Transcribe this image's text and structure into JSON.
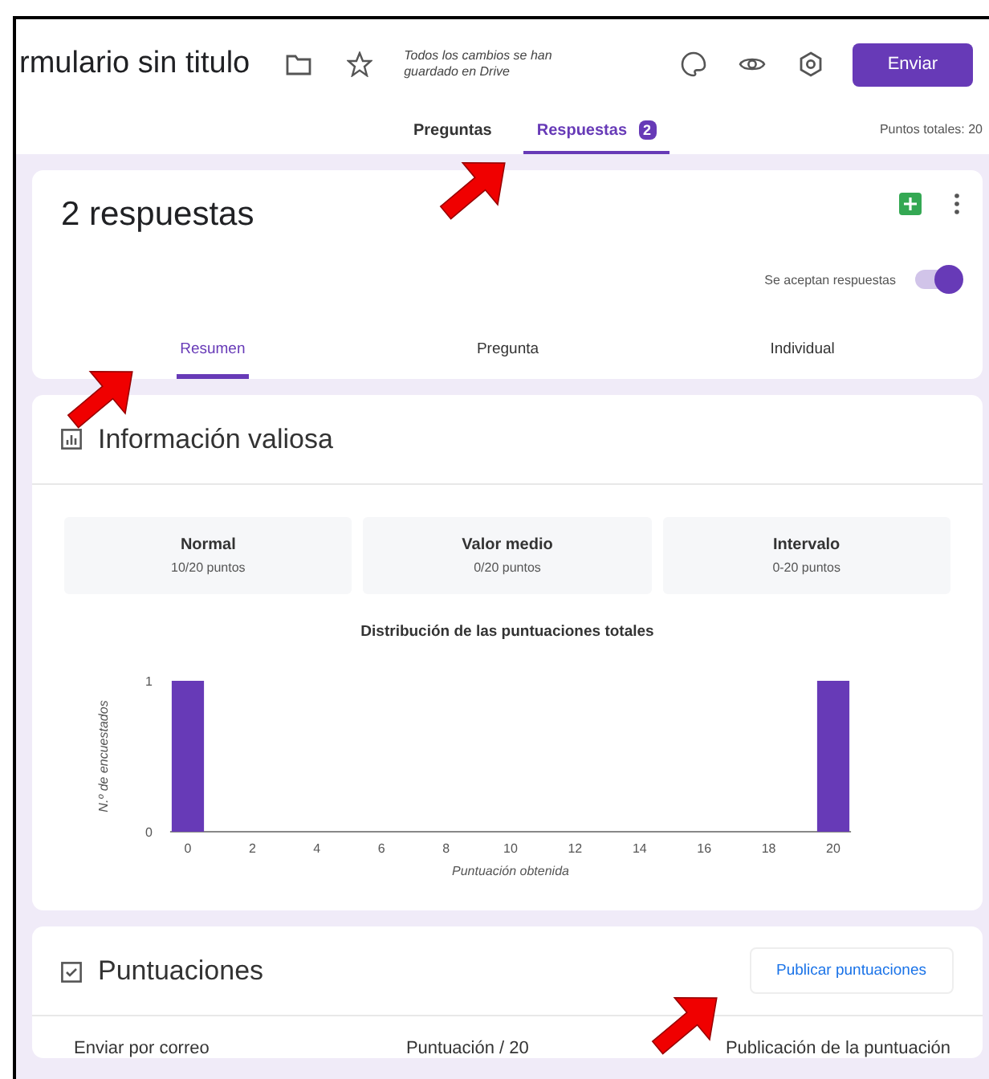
{
  "header": {
    "title": "rmulario sin titulo",
    "save_status": "Todos los cambios se han guardado en Drive",
    "send_button": "Enviar"
  },
  "tabs": [
    {
      "label": "Preguntas",
      "selected": false
    },
    {
      "label": "Respuestas",
      "selected": true,
      "badge": "2"
    }
  ],
  "total_points": "Puntos totales: 20",
  "responses_card": {
    "title": "2 respuestas",
    "accepting_label": "Se aceptan respuestas",
    "accepting": true,
    "tabs": [
      {
        "label": "Resumen",
        "selected": true
      },
      {
        "label": "Pregunta",
        "selected": false
      },
      {
        "label": "Individual",
        "selected": false
      }
    ]
  },
  "insights": {
    "title": "Información valiosa",
    "stats": [
      {
        "label": "Normal",
        "value": "10/20 puntos"
      },
      {
        "label": "Valor medio",
        "value": "0/20 puntos"
      },
      {
        "label": "Intervalo",
        "value": "0-20 puntos"
      }
    ],
    "chart_data": {
      "type": "bar",
      "title": "Distribución de las puntuaciones totales",
      "xlabel": "Puntuación obtenida",
      "ylabel": "N.º de encuestados",
      "x": [
        0,
        20
      ],
      "series": [
        {
          "color": "#673ab7",
          "values": [
            1,
            1
          ]
        }
      ],
      "xlim": [
        -0.5,
        20.5
      ],
      "ylim": [
        0,
        1
      ],
      "xticks": [
        0,
        2,
        4,
        6,
        8,
        10,
        12,
        14,
        16,
        18,
        20
      ],
      "yticks": [
        0,
        1
      ]
    }
  },
  "scores": {
    "title": "Puntuaciones",
    "publish_button": "Publicar puntuaciones",
    "columns": [
      "Enviar por correo",
      "Puntuación / 20",
      "Publicación de la puntuación"
    ]
  }
}
